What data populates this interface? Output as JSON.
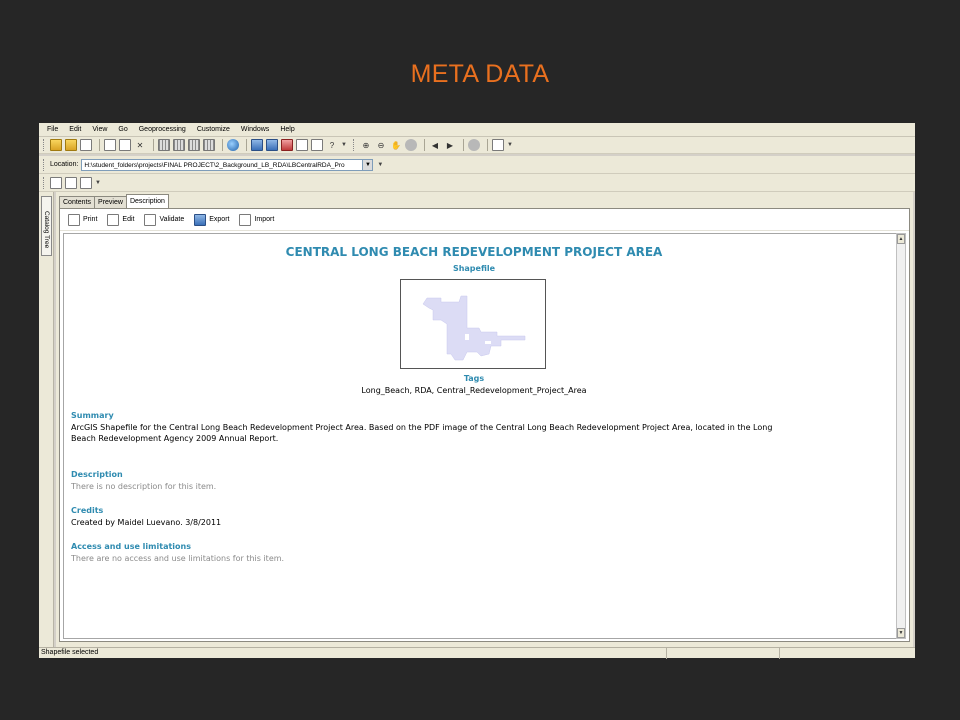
{
  "slide": {
    "title": "META DATA"
  },
  "menu": [
    "File",
    "Edit",
    "View",
    "Go",
    "Geoprocessing",
    "Customize",
    "Windows",
    "Help"
  ],
  "location": {
    "label": "Location:",
    "value": "H:\\student_folders\\projects\\FINAL PROJECT\\2_Background_LB_RDA\\LBCentralRDA_Pro"
  },
  "side_panel": {
    "label": "Catalog Tree"
  },
  "tabs": [
    "Contents",
    "Preview",
    "Description"
  ],
  "description_toolbar": [
    "Print",
    "Edit",
    "Validate",
    "Export",
    "Import"
  ],
  "document": {
    "title": "CENTRAL LONG BEACH REDEVELOPMENT PROJECT AREA",
    "subtitle": "Shapefile",
    "tags_heading": "Tags",
    "tags_value": "Long_Beach, RDA, Central_Redevelopment_Project_Area",
    "summary_heading": "Summary",
    "summary_line1": "ArcGIS Shapefile for the Central Long Beach Redevelopment Project Area. Based on the PDF image of the Central Long Beach Redevelopment Project Area, located in the Long",
    "summary_line2": "Beach Redevelopment Agency 2009 Annual Report.",
    "description_heading": "Description",
    "description_text": "There is no description for this item.",
    "credits_heading": "Credits",
    "credits_text": "Created by Maidel Luevano. 3/8/2011",
    "access_heading": "Access and use limitations",
    "access_text": "There are no access and use limitations for this item."
  },
  "status": {
    "text": "Shapefile selected"
  },
  "colors": {
    "accent_title": "#e9701f",
    "heading_blue": "#2f8bb0",
    "shape_fill": "#dcdcf5"
  }
}
